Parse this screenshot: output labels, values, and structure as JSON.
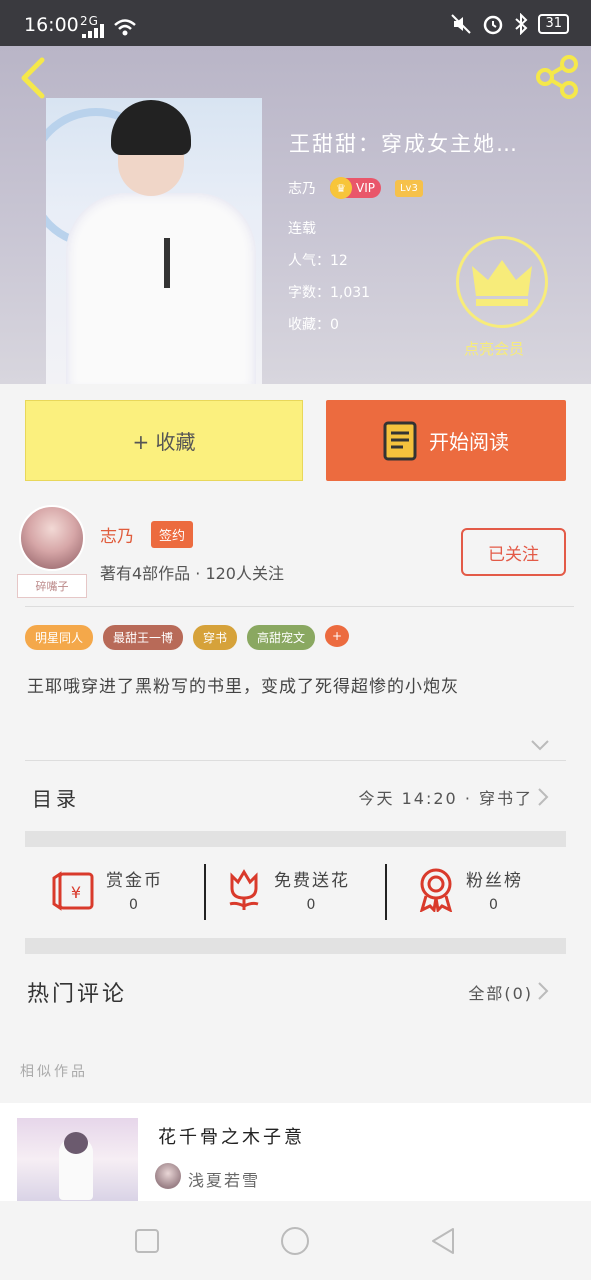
{
  "status_bar": {
    "time": "16:00",
    "signal": "2G",
    "battery": "31"
  },
  "book": {
    "title": "王甜甜：穿成女主她…",
    "author": "志乃",
    "vip_label": "VIP",
    "level_label": "Lv3",
    "status": "连载",
    "popularity": "人气：12",
    "word_count": "字数：1,031",
    "favorites": "收藏：0",
    "member_label": "点亮会员"
  },
  "buttons": {
    "collect": "+ 收藏",
    "read": "开始阅读"
  },
  "author_info": {
    "avatar_tag": "碎嘴子",
    "name": "志乃",
    "signed_badge": "签约",
    "stats": "著有4部作品 · 120人关注",
    "follow_label": "已关注"
  },
  "tags": [
    {
      "label": "明星同人",
      "color": "#f4a84a"
    },
    {
      "label": "最甜王一博",
      "color": "#b86a58"
    },
    {
      "label": "穿书",
      "color": "#d6a23a"
    },
    {
      "label": "高甜宠文",
      "color": "#8aa861"
    },
    {
      "label": "+",
      "color": "#ec6b3f"
    }
  ],
  "description": "王耶哦穿进了黑粉写的书里，变成了死得超惨的小炮灰",
  "toc": {
    "label": "目录",
    "latest": "今天 14:20 · 穿书了"
  },
  "actions": [
    {
      "label": "赏金币",
      "count": "0",
      "icon": "red-envelope-icon"
    },
    {
      "label": "免费送花",
      "count": "0",
      "icon": "flower-icon"
    },
    {
      "label": "粉丝榜",
      "count": "0",
      "icon": "medal-icon"
    }
  ],
  "comments": {
    "title": "热门评论",
    "all_label": "全部(0)"
  },
  "similar": {
    "label": "相似作品",
    "items": [
      {
        "title": "花千骨之木子意",
        "author": "浅夏若雪"
      }
    ]
  },
  "colors": {
    "accent": "#ec6b3f",
    "collect_bg": "#fbf07e",
    "member_yellow": "#f7ec7a"
  }
}
